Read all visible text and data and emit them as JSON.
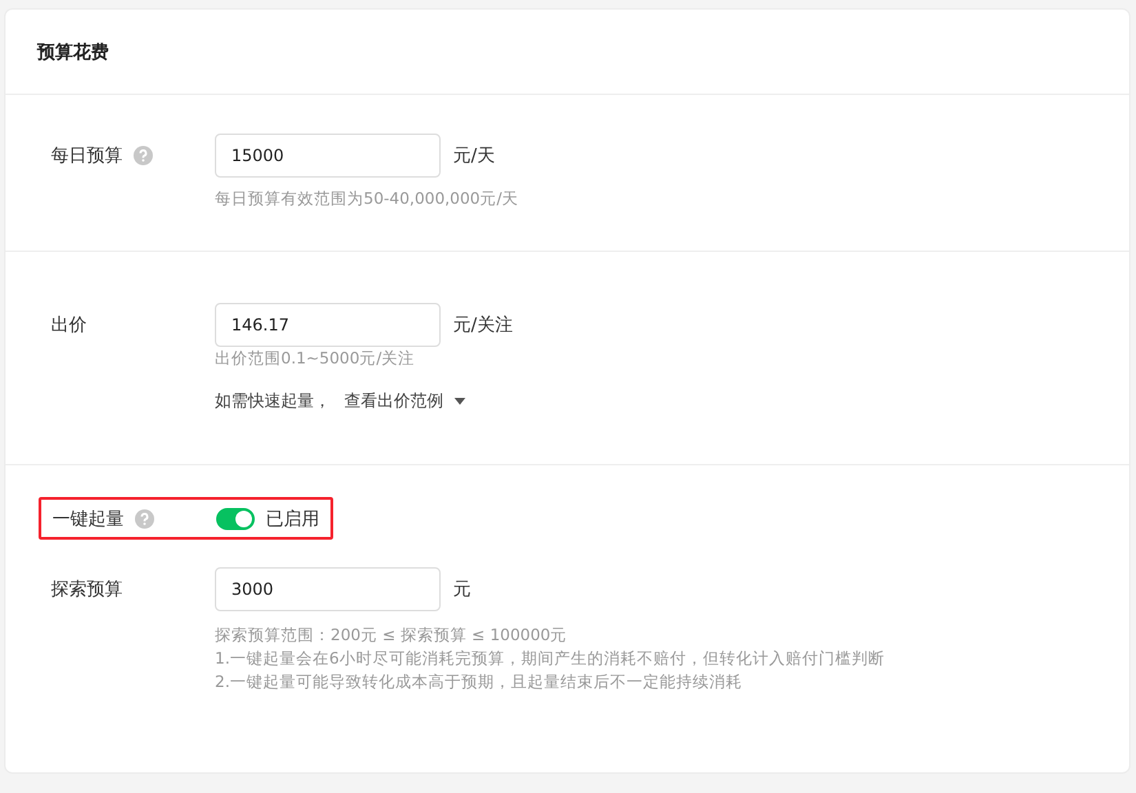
{
  "card": {
    "title": "预算花费"
  },
  "daily_budget": {
    "label": "每日预算",
    "has_help": true,
    "value": "15000",
    "unit": "元/天",
    "hint": "每日预算有效范围为50-40,000,000元/天"
  },
  "bid": {
    "label": "出价",
    "has_help": false,
    "value": "146.17",
    "unit": "元/关注",
    "hint": "出价范围0.1~5000元/关注",
    "tip": "如需快速起量，",
    "link": "查看出价范例"
  },
  "one_click_boost": {
    "label": "一键起量",
    "has_help": true,
    "on": true,
    "status": "已启用",
    "highlighted": true
  },
  "explore_budget": {
    "label": "探索预算",
    "value": "3000",
    "unit": "元",
    "notes": [
      "探索预算范围：200元 ≤ 探索预算 ≤ 100000元",
      "1.一键起量会在6小时尽可能消耗完预算，期间产生的消耗不赔付，但转化计入赔付门槛判断",
      "2.一键起量可能导致转化成本高于预期，且起量结束后不一定能持续消耗"
    ]
  }
}
